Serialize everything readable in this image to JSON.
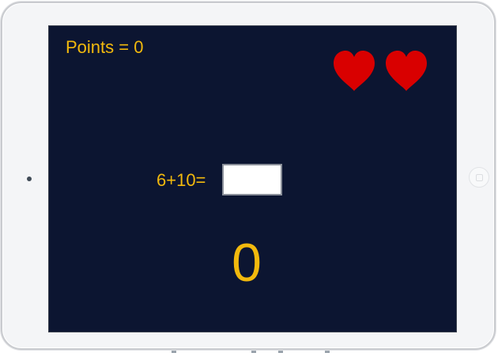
{
  "game": {
    "points_label": "Points = 0",
    "lives": 2,
    "question": "6+10=",
    "answer_value": "",
    "timer": "0"
  },
  "icons": {
    "life": "heart-icon"
  },
  "colors": {
    "screen_background": "#0c1531",
    "text_accent": "#f2b90d",
    "heart": "#d90000",
    "device_frame": "#f4f5f7"
  }
}
